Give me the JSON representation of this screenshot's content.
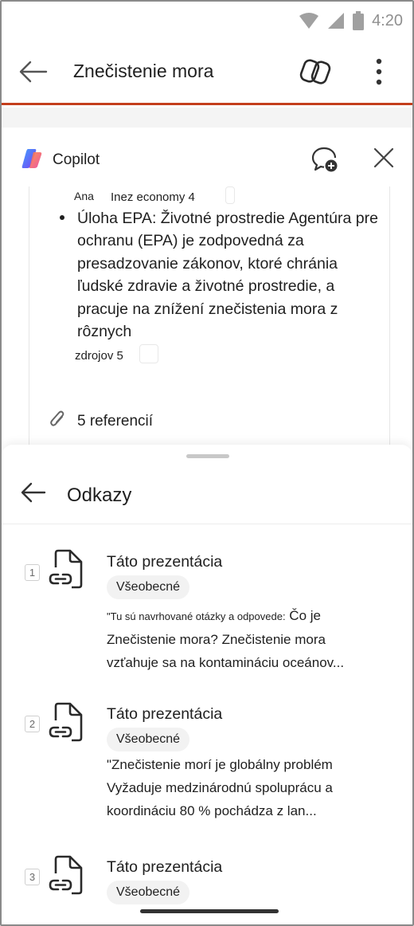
{
  "status_bar": {
    "time": "4:20"
  },
  "header": {
    "title": "Znečistenie mora"
  },
  "copilot": {
    "name": "Copilot",
    "card": {
      "prev_ref_author": "Ana",
      "prev_ref_source": "Inez economy 4",
      "bullet_text": "Úloha EPA: Životné prostredie Agentúra pre ochranu (EPA) je zodpovedná za presadzovanie zákonov, ktoré chránia ľudské zdravie a životné prostredie, a pracuje na znížení znečistenia mora z rôznych",
      "bullet_ref": "zdrojov 5",
      "references_count": "5 referencií"
    }
  },
  "references_sheet": {
    "title": "Odkazy",
    "items": [
      {
        "number": "1",
        "title": "Táto prezentácia",
        "tag": "Všeobecné",
        "snippet_lead": "\"Tu sú navrhované otázky a odpovede:",
        "snippet": "Čo je Znečistenie mora?    Znečistenie mora vzťahuje sa na kontamináciu oceánov..."
      },
      {
        "number": "2",
        "title": "Táto prezentácia",
        "tag": "Všeobecné",
        "snippet": "\"Znečistenie morí je globálny problém Vyžaduje medzinárodnú spoluprácu a koordináciu 80 % pochádza z lan..."
      },
      {
        "number": "3",
        "title": "Táto prezentácia",
        "tag": "Všeobecné"
      }
    ]
  }
}
